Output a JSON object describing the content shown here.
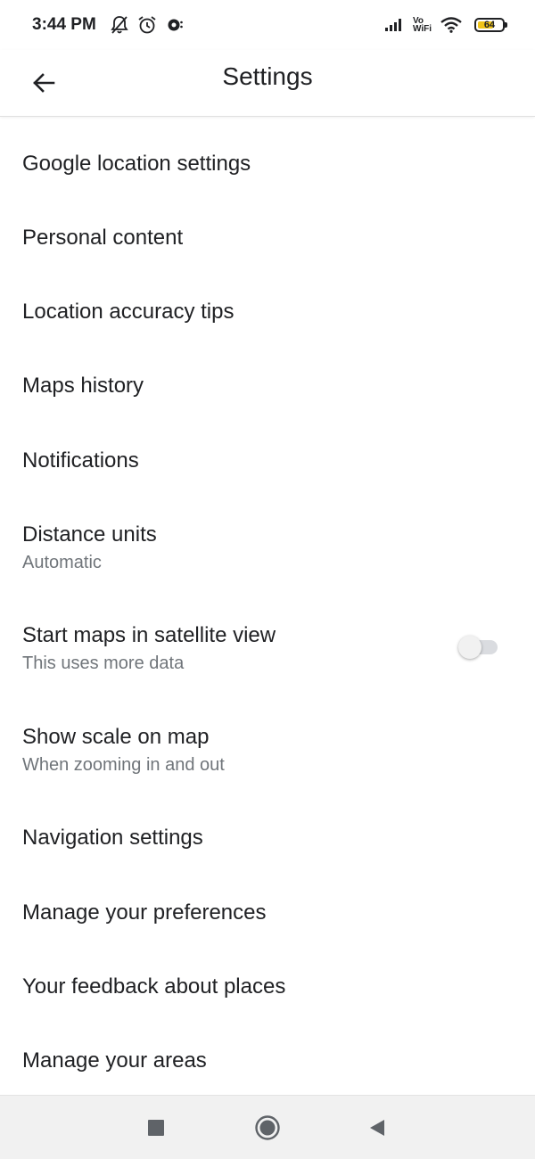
{
  "status_bar": {
    "time": "3:44 PM",
    "vowifi_top": "Vo",
    "vowifi_bottom": "WiFi",
    "battery_level": "64",
    "battery_fraction": 0.64,
    "battery_color": "#f0c419",
    "icons": [
      "notifications-off-icon",
      "alarm-icon",
      "app-notification-icon",
      "signal-icon",
      "vowifi-icon",
      "wifi-icon",
      "battery-icon"
    ]
  },
  "app_bar": {
    "back_icon": "arrow-back-icon",
    "title": "Settings"
  },
  "settings": {
    "items": [
      {
        "title": "Google location settings",
        "subtitle": ""
      },
      {
        "title": "Personal content",
        "subtitle": ""
      },
      {
        "title": "Location accuracy tips",
        "subtitle": ""
      },
      {
        "title": "Maps history",
        "subtitle": ""
      },
      {
        "title": "Notifications",
        "subtitle": ""
      },
      {
        "title": "Distance units",
        "subtitle": "Automatic"
      },
      {
        "title": "Start maps in satellite view",
        "subtitle": "This uses more data",
        "toggle": false
      },
      {
        "title": "Show scale on map",
        "subtitle": "When zooming in and out"
      },
      {
        "title": "Navigation settings",
        "subtitle": ""
      },
      {
        "title": "Manage your preferences",
        "subtitle": ""
      },
      {
        "title": "Your feedback about places",
        "subtitle": ""
      },
      {
        "title": "Manage your areas",
        "subtitle": ""
      }
    ]
  },
  "nav_bar": {
    "icons": [
      "recents-square-icon",
      "home-circle-icon",
      "back-triangle-icon"
    ]
  },
  "colors": {
    "text_primary": "#202124",
    "text_secondary": "#70757a",
    "nav_background": "#f1f1f1",
    "nav_icon": "#5f6368"
  }
}
